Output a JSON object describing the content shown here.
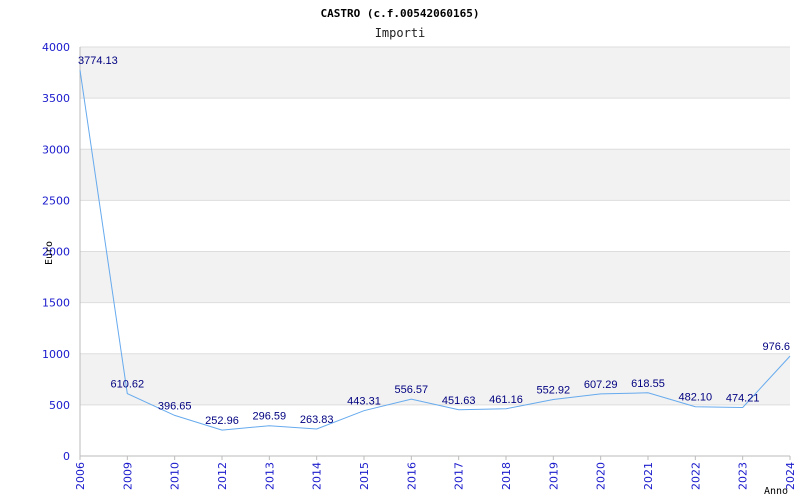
{
  "chart_data": {
    "type": "line",
    "title": "CASTRO (c.f.00542060165)",
    "subtitle": "Importi",
    "xlabel": "Anno",
    "ylabel": "Euro",
    "categories": [
      "2006",
      "2009",
      "2010",
      "2012",
      "2013",
      "2014",
      "2015",
      "2016",
      "2017",
      "2018",
      "2019",
      "2020",
      "2021",
      "2022",
      "2023",
      "2024"
    ],
    "values": [
      3774.13,
      610.62,
      396.65,
      252.96,
      296.59,
      263.83,
      443.31,
      556.57,
      451.63,
      461.16,
      552.92,
      607.29,
      618.55,
      482.1,
      474.21,
      976.6
    ],
    "value_labels": [
      "3774.13",
      "610.62",
      "396.65",
      "252.96",
      "296.59",
      "263.83",
      "443.31",
      "556.57",
      "451.63",
      "461.16",
      "552.92",
      "607.29",
      "618.55",
      "482.10",
      "474.21",
      "976.6"
    ],
    "ylim": [
      0,
      4000
    ],
    "yticks": [
      "0",
      "500",
      "1000",
      "1500",
      "2000",
      "2500",
      "3000",
      "3500",
      "4000"
    ],
    "ytick_values": [
      0,
      500,
      1000,
      1500,
      2000,
      2500,
      3000,
      3500,
      4000
    ],
    "grid": true,
    "colors": {
      "line": "#66aaee",
      "band": "#f2f2f2",
      "grid": "#dddddd",
      "tick_text": "#1a1acc",
      "data_label": "#000080"
    }
  }
}
